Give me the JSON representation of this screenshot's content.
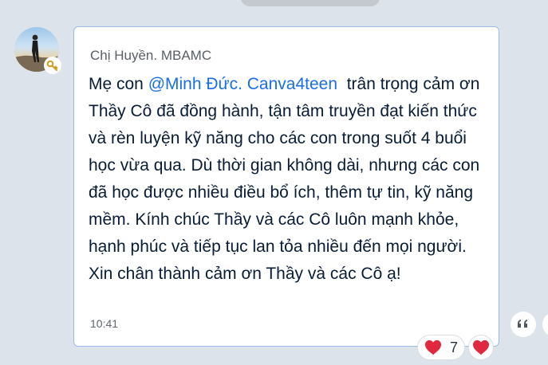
{
  "message": {
    "sender": "Chị Huyền. MBAMC",
    "text_before_mention": "Mẹ con ",
    "mention": "@Minh Đức. Canva4teen",
    "text_after_mention": "  trân trọng cảm ơn Thầy Cô đã đồng hành, tận tâm truyền đạt kiến thức và rèn luyện kỹ năng cho các con trong suốt 4 buổi học vừa qua. Dù thời gian không dài, nhưng các con đã học được nhiều điều bổ ích, thêm tự tin, kỹ năng mềm. Kính chúc Thầy và các Cô luôn mạnh khỏe, hạnh phúc và tiếp tục lan tỏa nhiều đến mọi người. Xin chân thành cảm ơn Thầy và các Cô ạ!",
    "time": "10:41"
  },
  "reactions": {
    "count": "7",
    "icon": "heart-icon"
  },
  "colors": {
    "background": "#dde3ea",
    "bubble_border": "#9dbbe8",
    "mention": "#1a6fe6",
    "text": "#081c36",
    "heart": "#e0283e"
  }
}
